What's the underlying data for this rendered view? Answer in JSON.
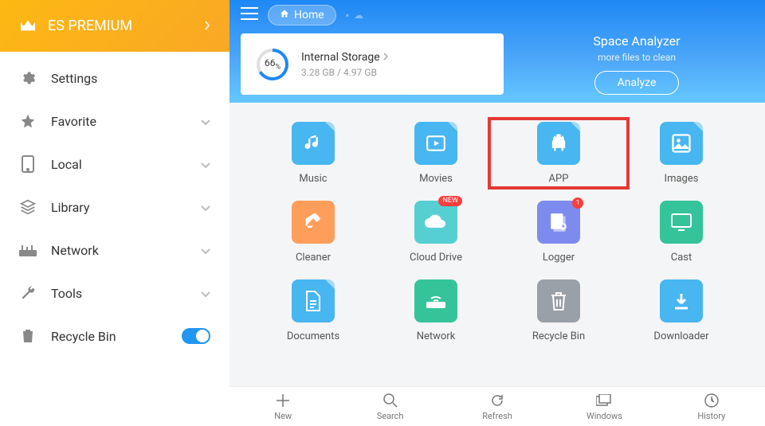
{
  "premium": {
    "label": "ES PREMIUM"
  },
  "sidebar": {
    "items": [
      {
        "label": "Settings"
      },
      {
        "label": "Favorite"
      },
      {
        "label": "Local"
      },
      {
        "label": "Library"
      },
      {
        "label": "Network"
      },
      {
        "label": "Tools"
      },
      {
        "label": "Recycle Bin"
      }
    ]
  },
  "breadcrumb": {
    "home_label": "Home"
  },
  "storage": {
    "percent": "66",
    "percent_unit": "%",
    "name": "Internal Storage",
    "used": "3.28 GB",
    "total": "4.97 GB",
    "sep": " / "
  },
  "analyzer": {
    "title": "Space Analyzer",
    "subtitle": "more files to clean",
    "button": "Analyze"
  },
  "tiles": [
    {
      "label": "Music",
      "color": "#47B6F1"
    },
    {
      "label": "Movies",
      "color": "#47B6F1"
    },
    {
      "label": "APP",
      "color": "#47B6F1"
    },
    {
      "label": "Images",
      "color": "#47B6F1"
    },
    {
      "label": "Cleaner",
      "color": "#FF9E5B"
    },
    {
      "label": "Cloud Drive",
      "color": "#56CFD2",
      "badge": "NEW"
    },
    {
      "label": "Logger",
      "color": "#7E8BEE",
      "badge_num": "1"
    },
    {
      "label": "Cast",
      "color": "#35C49A"
    },
    {
      "label": "Documents",
      "color": "#47B6F1"
    },
    {
      "label": "Network",
      "color": "#35C49A"
    },
    {
      "label": "Recycle Bin",
      "color": "#9AA0A7"
    },
    {
      "label": "Downloader",
      "color": "#47B6F1"
    }
  ],
  "bottombar": {
    "items": [
      {
        "label": "New"
      },
      {
        "label": "Search"
      },
      {
        "label": "Refresh"
      },
      {
        "label": "Windows"
      },
      {
        "label": "History"
      }
    ]
  }
}
